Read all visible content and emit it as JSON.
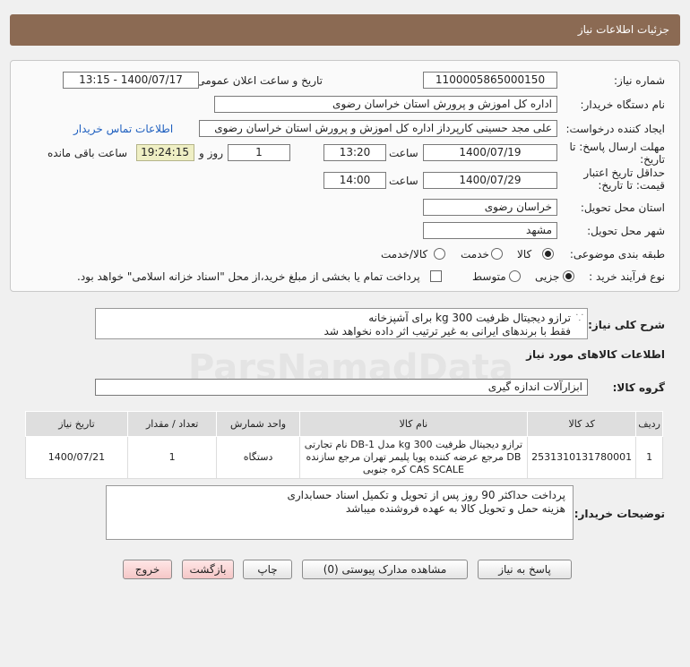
{
  "header": {
    "title": "جزئیات اطلاعات نیاز"
  },
  "fields": {
    "need_number_label": "شماره نیاز:",
    "need_number": "1100005865000150",
    "announce_label": "تاریخ و ساعت اعلان عمومی:",
    "announce_value": "1400/07/17 - 13:15",
    "buyer_org_label": "نام دستگاه خریدار:",
    "buyer_org": "اداره کل اموزش و پرورش استان خراسان رضوی",
    "requester_label": "ایجاد کننده درخواست:",
    "requester": "علی مجد حسینی کارپرداز اداره کل اموزش و پرورش استان خراسان رضوی",
    "contact_link": "اطلاعات تماس خریدار",
    "deadline_label": "مهلت ارسال پاسخ: تا تاریخ:",
    "deadline_date": "1400/07/19",
    "time_label": "ساعت",
    "deadline_time": "13:20",
    "days_value": "1",
    "days_label": "روز و",
    "remaining_time": "19:24:15",
    "remaining_label": "ساعت باقی مانده",
    "validity_label": "حداقل تاریخ اعتبار قیمت: تا تاریخ:",
    "validity_date": "1400/07/29",
    "validity_time": "14:00",
    "province_label": "استان محل تحویل:",
    "province": "خراسان رضوی",
    "city_label": "شهر محل تحویل:",
    "city": "مشهد",
    "category_label": "طبقه بندی موضوعی:",
    "category_options": [
      "کالا",
      "خدمت",
      "کالا/خدمت"
    ],
    "process_label": "نوع فرآیند خرید :",
    "process_options": [
      "جزیی",
      "متوسط"
    ],
    "treasury_note": "پرداخت تمام یا بخشی از مبلغ خرید،از محل \"اسناد خزانه اسلامی\" خواهد بود."
  },
  "summary": {
    "label": "شرح کلی نیاز:",
    "line1": "ترازو دیجیتال ظرفیت 300 kg برای آشپزخانه",
    "line2": "فقط با برندهای ایرانی به غیر ترتیب اثر داده نخواهد شد"
  },
  "goods_info_title": "اطلاعات کالاهای مورد نیاز",
  "goods_group": {
    "label": "گروه کالا:",
    "value": "ابزارآلات اندازه گیری"
  },
  "table": {
    "headers": [
      "ردیف",
      "کد کالا",
      "نام کالا",
      "واحد شمارش",
      "تعداد / مقدار",
      "تاریخ نیاز"
    ],
    "rows": [
      {
        "index": "1",
        "code": "2531310131780001",
        "name": "ترازو دیجیتال ظرفیت 300 kg مدل DB-1 نام تجارتی DB مرجع عرضه کننده پویا پلیمر تهران مرجع سازنده CAS SCALE کره جنوبی",
        "unit": "دستگاه",
        "qty": "1",
        "date": "1400/07/21"
      }
    ]
  },
  "buyer_notes": {
    "label": "توضیحات خریدار:",
    "line1": "پرداخت حداکثر 90 روز پس از تحویل و تکمیل اسناد حسابداری",
    "line2": "هزینه حمل و تحویل کالا به عهده فروشنده میباشد"
  },
  "buttons": {
    "reply": "پاسخ به نیاز",
    "attachments": "مشاهده مدارک پیوستی (0)",
    "print": "چاپ",
    "back": "بازگشت",
    "exit": "خروج"
  },
  "watermark": {
    "brand": "ParsNamadData"
  }
}
